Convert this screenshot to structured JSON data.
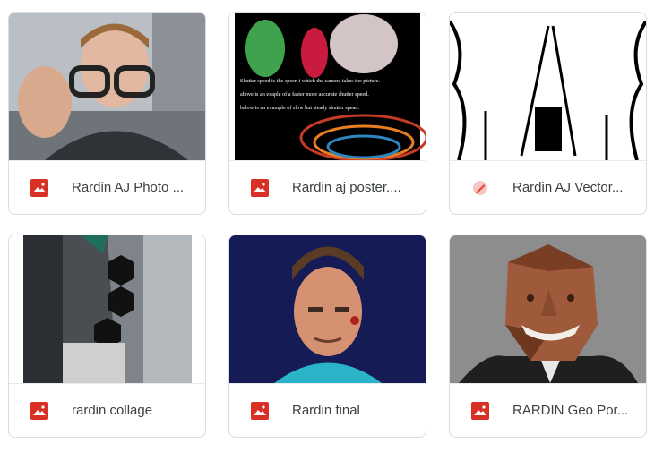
{
  "files": [
    {
      "name": "Rardin AJ Photo ...",
      "icon": "image-file-icon",
      "color": "#d93025"
    },
    {
      "name": "Rardin aj poster....",
      "icon": "image-file-icon",
      "color": "#d93025"
    },
    {
      "name": "Rardin AJ Vector...",
      "icon": "drawing-file-icon",
      "color": "#ea4335"
    },
    {
      "name": "rardin collage",
      "icon": "image-file-icon",
      "color": "#d93025"
    },
    {
      "name": "Rardin final",
      "icon": "image-file-icon",
      "color": "#d93025"
    },
    {
      "name": "RARDIN Geo Por...",
      "icon": "image-file-icon",
      "color": "#d93025"
    }
  ],
  "poster": {
    "line1": "Shutter speed is the speen i which the camera takes the picture.",
    "line2": "above is an exaple of a faster more accurate shutter speed.",
    "line3": "below is an example of slow but steady shutter spead."
  }
}
